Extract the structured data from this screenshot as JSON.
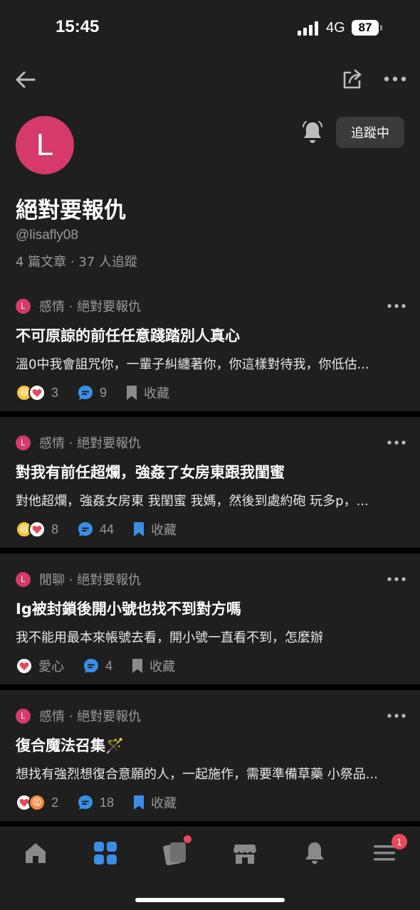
{
  "status": {
    "time": "15:45",
    "network": "4G",
    "battery": "87"
  },
  "profile": {
    "avatar_letter": "L",
    "name": "絕對要報仇",
    "handle": "@lisafly08",
    "stats": "4 篇文章 · 37 人追蹤",
    "follow_label": "追蹤中"
  },
  "posts": [
    {
      "meta": "感情 · 絕對要報仇",
      "avatar_letter": "L",
      "title": "不可原諒的前任任意踐踏別人真心",
      "excerpt": "溫0中我會詛咒你，一輩子糾纏著你，你這樣對待我，你低估...",
      "reaction_count": "3",
      "comment_count": "9",
      "save_label": "收藏",
      "reactions": [
        "laugh",
        "heart"
      ],
      "saved": false
    },
    {
      "meta": "感情 · 絕對要報仇",
      "avatar_letter": "L",
      "title": "對我有前任超爛，強姦了女房東跟我閨蜜",
      "excerpt": "對他超爛，強姦女房東 我閨蜜 我媽，然後到處約砲 玩多p，...",
      "reaction_count": "8",
      "comment_count": "44",
      "save_label": "收藏",
      "reactions": [
        "laugh",
        "heart"
      ],
      "saved": true
    },
    {
      "meta": "閒聊 · 絕對要報仇",
      "avatar_letter": "L",
      "title": "Ig被封鎖後開小號也找不到對方嗎",
      "excerpt": "我不能用最本來帳號去看，開小號一直看不到，怎麼辦",
      "reaction_count": "愛心",
      "comment_count": "4",
      "save_label": "收藏",
      "reactions": [
        "heart"
      ],
      "saved": false
    },
    {
      "meta": "感情 · 絕對要報仇",
      "avatar_letter": "L",
      "title": "復合魔法召集🪄",
      "excerpt": "想找有強烈想復合意願的人，一起施作，需要準備草藥 小祭品...",
      "reaction_count": "2",
      "comment_count": "18",
      "save_label": "收藏",
      "reactions": [
        "heart",
        "angry"
      ],
      "saved": true
    }
  ],
  "tabbar": {
    "menu_badge": "1"
  },
  "colors": {
    "background": "#1f1f1f",
    "accent_blue": "#3a8ee6",
    "avatar_pink": "#d63a6b",
    "muted": "#9a9a9a",
    "badge_red": "#e8485a"
  }
}
